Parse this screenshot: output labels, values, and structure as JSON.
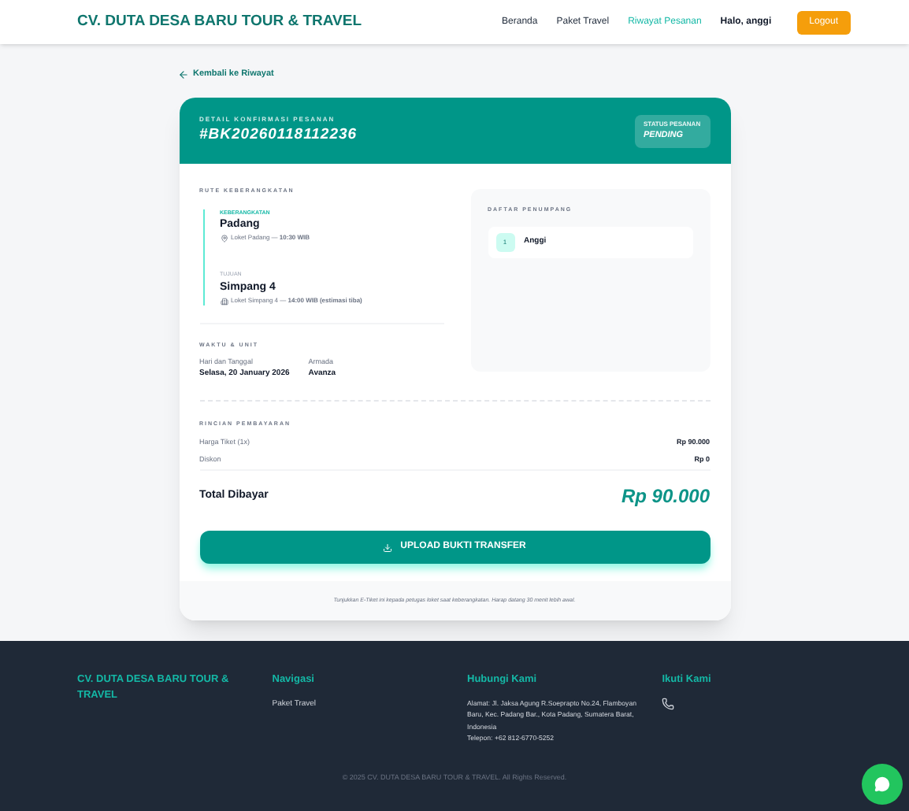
{
  "header": {
    "brand": "CV. DUTA DESA BARU TOUR & TRAVEL",
    "nav": [
      {
        "label": "Beranda",
        "selected": false
      },
      {
        "label": "Paket Travel",
        "selected": false
      },
      {
        "label": "Riwayat Pesanan",
        "selected": true
      }
    ],
    "greeting": "Halo, anggi",
    "logout": "Logout"
  },
  "back_link": "Kembali ke Riwayat",
  "booking": {
    "caption": "DETAIL KONFIRMASI PESANAN",
    "code": "#BK20260118112236",
    "status_label": "STATUS PESANAN",
    "status": "PENDING"
  },
  "route": {
    "title": "RUTE KEBERANGKATAN",
    "stops": [
      {
        "kind": "departure",
        "label": "KEBERANGKATAN",
        "city": "Padang",
        "detail": "Loket Padang — **10:30 WIB**"
      },
      {
        "kind": "arrival",
        "label": "TUJUAN",
        "city": "Simpang 4",
        "detail": "Loket Simpang 4 — **14:00 WIB (estimasi tiba)**"
      }
    ]
  },
  "time_unit": {
    "title": "WAKTU & UNIT",
    "fields": [
      {
        "label": "Hari dan Tanggal",
        "value": "Selasa, 20 January 2026"
      },
      {
        "label": "Armada",
        "value": "Avanza"
      }
    ]
  },
  "passengers": {
    "title": "DAFTAR PENUMPANG",
    "items": [
      {
        "number": "1",
        "name": "Anggi"
      }
    ]
  },
  "payment": {
    "title": "RINCIAN PEMBAYARAN",
    "lines": [
      {
        "label": "Harga Tiket (1x)",
        "value": "Rp 90.000"
      },
      {
        "label": "Diskon",
        "value": "Rp 0"
      }
    ],
    "total_label": "Total Dibayar",
    "total": "Rp 90.000",
    "upload_button": "UPLOAD BUKTI TRANSFER"
  },
  "note": "Tunjukkan E-Tiket ini kepada petugas loket saat keberangkatan. Harap datang 30 menit lebih awal.",
  "footer": {
    "brand": "CV. DUTA DESA BARU TOUR & TRAVEL",
    "nav_title": "Navigasi",
    "nav_links": [
      "Paket Travel"
    ],
    "contact_title": "Hubungi Kami",
    "address": "Alamat: Jl. Jaksa Agung R.Soeprapto No.24, Flamboyan Baru, Kec. Padang Bar., Kota Padang, Sumatera Barat, Indonesia",
    "phone": "Telepon: +62 812-6770-5252",
    "follow_title": "Ikuti Kami",
    "copyright": "© 2025 CV. DUTA DESA BARU TOUR & TRAVEL. All Rights Reserved."
  }
}
